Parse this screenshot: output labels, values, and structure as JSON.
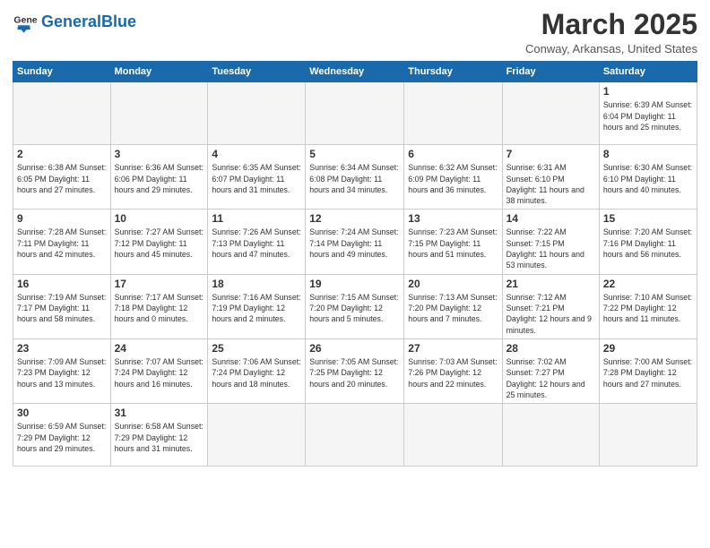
{
  "logo": {
    "text_general": "General",
    "text_blue": "Blue"
  },
  "header": {
    "month": "March 2025",
    "location": "Conway, Arkansas, United States"
  },
  "weekdays": [
    "Sunday",
    "Monday",
    "Tuesday",
    "Wednesday",
    "Thursday",
    "Friday",
    "Saturday"
  ],
  "weeks": [
    [
      {
        "day": "",
        "info": ""
      },
      {
        "day": "",
        "info": ""
      },
      {
        "day": "",
        "info": ""
      },
      {
        "day": "",
        "info": ""
      },
      {
        "day": "",
        "info": ""
      },
      {
        "day": "",
        "info": ""
      },
      {
        "day": "1",
        "info": "Sunrise: 6:39 AM\nSunset: 6:04 PM\nDaylight: 11 hours and 25 minutes."
      }
    ],
    [
      {
        "day": "2",
        "info": "Sunrise: 6:38 AM\nSunset: 6:05 PM\nDaylight: 11 hours and 27 minutes."
      },
      {
        "day": "3",
        "info": "Sunrise: 6:36 AM\nSunset: 6:06 PM\nDaylight: 11 hours and 29 minutes."
      },
      {
        "day": "4",
        "info": "Sunrise: 6:35 AM\nSunset: 6:07 PM\nDaylight: 11 hours and 31 minutes."
      },
      {
        "day": "5",
        "info": "Sunrise: 6:34 AM\nSunset: 6:08 PM\nDaylight: 11 hours and 34 minutes."
      },
      {
        "day": "6",
        "info": "Sunrise: 6:32 AM\nSunset: 6:09 PM\nDaylight: 11 hours and 36 minutes."
      },
      {
        "day": "7",
        "info": "Sunrise: 6:31 AM\nSunset: 6:10 PM\nDaylight: 11 hours and 38 minutes."
      },
      {
        "day": "8",
        "info": "Sunrise: 6:30 AM\nSunset: 6:10 PM\nDaylight: 11 hours and 40 minutes."
      }
    ],
    [
      {
        "day": "9",
        "info": "Sunrise: 7:28 AM\nSunset: 7:11 PM\nDaylight: 11 hours and 42 minutes."
      },
      {
        "day": "10",
        "info": "Sunrise: 7:27 AM\nSunset: 7:12 PM\nDaylight: 11 hours and 45 minutes."
      },
      {
        "day": "11",
        "info": "Sunrise: 7:26 AM\nSunset: 7:13 PM\nDaylight: 11 hours and 47 minutes."
      },
      {
        "day": "12",
        "info": "Sunrise: 7:24 AM\nSunset: 7:14 PM\nDaylight: 11 hours and 49 minutes."
      },
      {
        "day": "13",
        "info": "Sunrise: 7:23 AM\nSunset: 7:15 PM\nDaylight: 11 hours and 51 minutes."
      },
      {
        "day": "14",
        "info": "Sunrise: 7:22 AM\nSunset: 7:15 PM\nDaylight: 11 hours and 53 minutes."
      },
      {
        "day": "15",
        "info": "Sunrise: 7:20 AM\nSunset: 7:16 PM\nDaylight: 11 hours and 56 minutes."
      }
    ],
    [
      {
        "day": "16",
        "info": "Sunrise: 7:19 AM\nSunset: 7:17 PM\nDaylight: 11 hours and 58 minutes."
      },
      {
        "day": "17",
        "info": "Sunrise: 7:17 AM\nSunset: 7:18 PM\nDaylight: 12 hours and 0 minutes."
      },
      {
        "day": "18",
        "info": "Sunrise: 7:16 AM\nSunset: 7:19 PM\nDaylight: 12 hours and 2 minutes."
      },
      {
        "day": "19",
        "info": "Sunrise: 7:15 AM\nSunset: 7:20 PM\nDaylight: 12 hours and 5 minutes."
      },
      {
        "day": "20",
        "info": "Sunrise: 7:13 AM\nSunset: 7:20 PM\nDaylight: 12 hours and 7 minutes."
      },
      {
        "day": "21",
        "info": "Sunrise: 7:12 AM\nSunset: 7:21 PM\nDaylight: 12 hours and 9 minutes."
      },
      {
        "day": "22",
        "info": "Sunrise: 7:10 AM\nSunset: 7:22 PM\nDaylight: 12 hours and 11 minutes."
      }
    ],
    [
      {
        "day": "23",
        "info": "Sunrise: 7:09 AM\nSunset: 7:23 PM\nDaylight: 12 hours and 13 minutes."
      },
      {
        "day": "24",
        "info": "Sunrise: 7:07 AM\nSunset: 7:24 PM\nDaylight: 12 hours and 16 minutes."
      },
      {
        "day": "25",
        "info": "Sunrise: 7:06 AM\nSunset: 7:24 PM\nDaylight: 12 hours and 18 minutes."
      },
      {
        "day": "26",
        "info": "Sunrise: 7:05 AM\nSunset: 7:25 PM\nDaylight: 12 hours and 20 minutes."
      },
      {
        "day": "27",
        "info": "Sunrise: 7:03 AM\nSunset: 7:26 PM\nDaylight: 12 hours and 22 minutes."
      },
      {
        "day": "28",
        "info": "Sunrise: 7:02 AM\nSunset: 7:27 PM\nDaylight: 12 hours and 25 minutes."
      },
      {
        "day": "29",
        "info": "Sunrise: 7:00 AM\nSunset: 7:28 PM\nDaylight: 12 hours and 27 minutes."
      }
    ],
    [
      {
        "day": "30",
        "info": "Sunrise: 6:59 AM\nSunset: 7:29 PM\nDaylight: 12 hours and 29 minutes."
      },
      {
        "day": "31",
        "info": "Sunrise: 6:58 AM\nSunset: 7:29 PM\nDaylight: 12 hours and 31 minutes."
      },
      {
        "day": "",
        "info": ""
      },
      {
        "day": "",
        "info": ""
      },
      {
        "day": "",
        "info": ""
      },
      {
        "day": "",
        "info": ""
      },
      {
        "day": "",
        "info": ""
      }
    ]
  ]
}
